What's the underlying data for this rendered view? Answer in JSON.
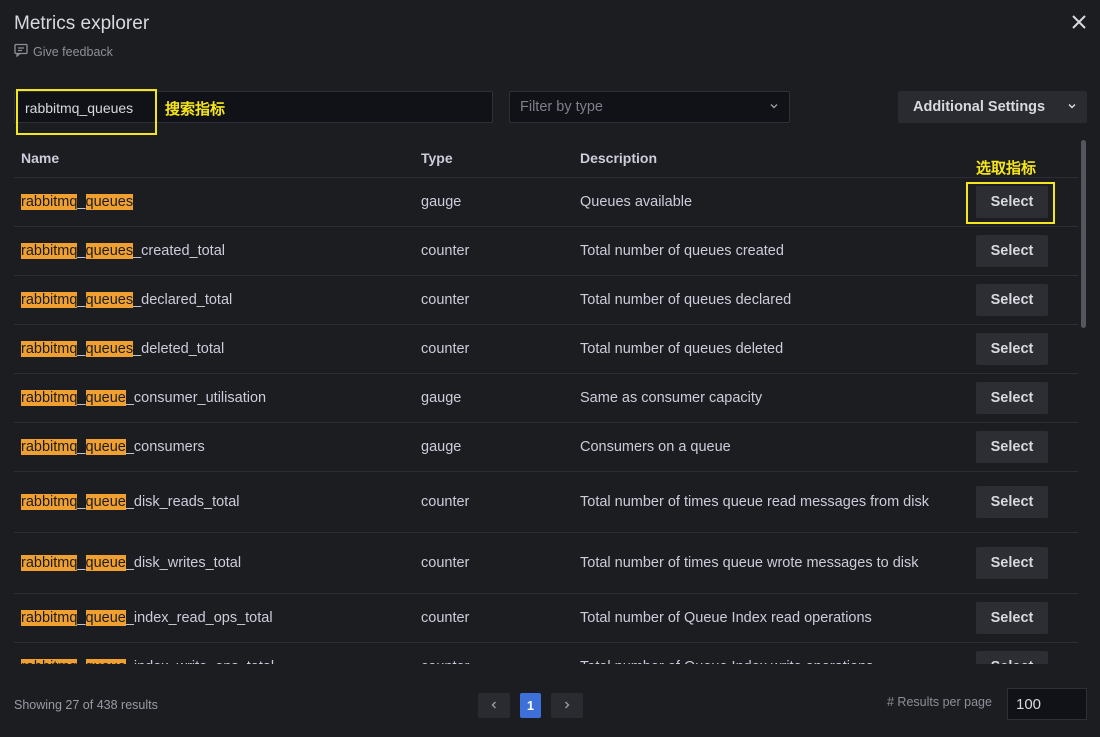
{
  "header": {
    "title": "Metrics explorer",
    "feedback_label": "Give feedback"
  },
  "search": {
    "value": "rabbitmq_queues",
    "annotation": "搜索指标"
  },
  "filter": {
    "placeholder": "Filter by type"
  },
  "settings": {
    "label": "Additional Settings"
  },
  "table": {
    "columns": {
      "name": "Name",
      "type": "Type",
      "description": "Description"
    },
    "select_annotation": "选取指标",
    "select_label": "Select",
    "rows": [
      {
        "name_parts": [
          "rabbitmq",
          "_",
          "queues",
          ""
        ],
        "type": "gauge",
        "description": "Queues available"
      },
      {
        "name_parts": [
          "rabbitmq",
          "_",
          "queues",
          "_created_total"
        ],
        "type": "counter",
        "description": "Total number of queues created"
      },
      {
        "name_parts": [
          "rabbitmq",
          "_",
          "queues",
          "_declared_total"
        ],
        "type": "counter",
        "description": "Total number of queues declared"
      },
      {
        "name_parts": [
          "rabbitmq",
          "_",
          "queues",
          "_deleted_total"
        ],
        "type": "counter",
        "description": "Total number of queues deleted"
      },
      {
        "name_parts": [
          "rabbitmq",
          "_",
          "queue",
          "_consumer_utilisation"
        ],
        "type": "gauge",
        "description": "Same as consumer capacity"
      },
      {
        "name_parts": [
          "rabbitmq",
          "_",
          "queue",
          "_consumers"
        ],
        "type": "gauge",
        "description": "Consumers on a queue"
      },
      {
        "name_parts": [
          "rabbitmq",
          "_",
          "queue",
          "_disk_reads_total"
        ],
        "type": "counter",
        "description": "Total number of times queue read messages from disk"
      },
      {
        "name_parts": [
          "rabbitmq",
          "_",
          "queue",
          "_disk_writes_total"
        ],
        "type": "counter",
        "description": "Total number of times queue wrote messages to disk"
      },
      {
        "name_parts": [
          "rabbitmq",
          "_",
          "queue",
          "_index_read_ops_total"
        ],
        "type": "counter",
        "description": "Total number of Queue Index read operations"
      },
      {
        "name_parts": [
          "rabbitmq",
          "_",
          "queue",
          "_index_write_ops_total"
        ],
        "type": "counter",
        "description": "Total number of Queue Index write operations"
      }
    ]
  },
  "footer": {
    "results_summary": "Showing 27 of 438 results",
    "current_page": "1",
    "results_per_page_label": "# Results per page",
    "results_per_page": "100"
  },
  "colors": {
    "match_highlight": "#f0a030",
    "annotation": "#f5e51d",
    "page_active": "#3d71d9"
  }
}
